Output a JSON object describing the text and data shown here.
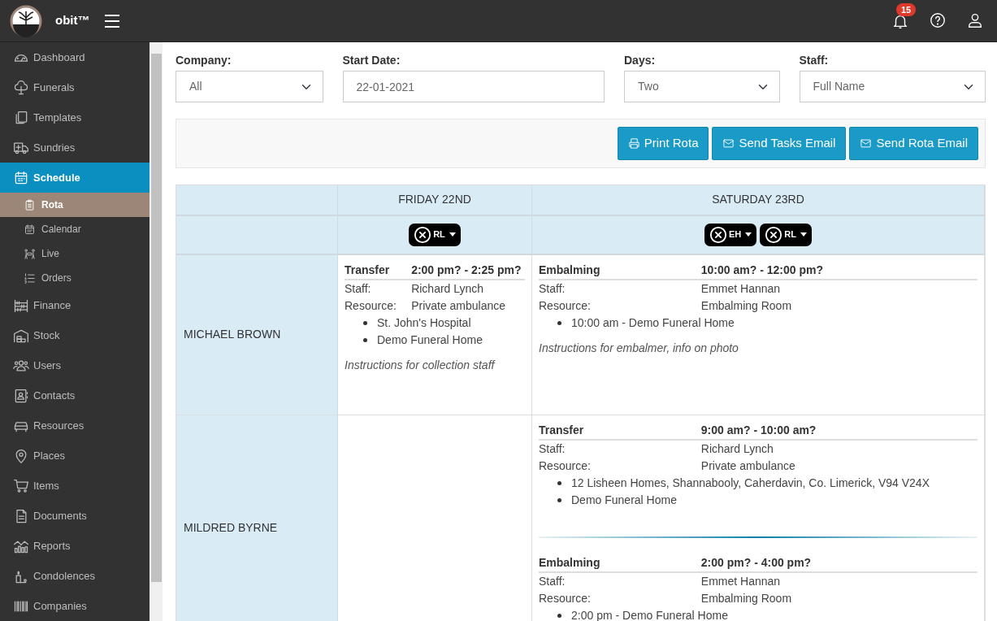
{
  "app": {
    "name": "obit™"
  },
  "header": {
    "notifications": "15"
  },
  "sidebar": {
    "items": [
      {
        "label": "Dashboard",
        "selected": false
      },
      {
        "label": "Funerals",
        "selected": false
      },
      {
        "label": "Templates",
        "selected": false
      },
      {
        "label": "Sundries",
        "selected": false
      },
      {
        "label": "Schedule",
        "selected": true,
        "children": [
          {
            "label": "Rota",
            "selected": true
          },
          {
            "label": "Calendar",
            "selected": false
          },
          {
            "label": "Live",
            "selected": false
          },
          {
            "label": "Orders",
            "selected": false
          }
        ]
      },
      {
        "label": "Finance",
        "selected": false
      },
      {
        "label": "Stock",
        "selected": false
      },
      {
        "label": "Users",
        "selected": false
      },
      {
        "label": "Contacts",
        "selected": false
      },
      {
        "label": "Resources",
        "selected": false
      },
      {
        "label": "Places",
        "selected": false
      },
      {
        "label": "Items",
        "selected": false
      },
      {
        "label": "Documents",
        "selected": false
      },
      {
        "label": "Reports",
        "selected": false
      },
      {
        "label": "Condolences",
        "selected": false
      },
      {
        "label": "Companies",
        "selected": false
      }
    ]
  },
  "filters": [
    {
      "label": "Company:",
      "kind": "select",
      "value": "All"
    },
    {
      "label": "Start Date:",
      "kind": "input",
      "value": "22-01-2021"
    },
    {
      "label": "Days:",
      "kind": "select",
      "value": "Two"
    },
    {
      "label": "Staff:",
      "kind": "select",
      "value": "Full Name"
    }
  ],
  "actions": [
    {
      "label": "Print Rota",
      "kind": "print"
    },
    {
      "label": "Send Tasks Email",
      "kind": "email"
    },
    {
      "label": "Send Rota Email",
      "kind": "email"
    }
  ],
  "rota": {
    "days": [
      {
        "title": "FRIDAY 22ND",
        "staff": [
          "RL"
        ]
      },
      {
        "title": "SATURDAY 23RD",
        "staff": [
          "EH",
          "RL"
        ]
      }
    ],
    "rows": [
      {
        "name": "MICHAEL BROWN",
        "cells": [
          [
            {
              "type": "Transfer",
              "time": "2:00 pm? - 2:25 pm?",
              "staff_label": "Staff:",
              "staff": "Richard Lynch",
              "resource_label": "Resource:",
              "resource": "Private ambulance",
              "stops": [
                "St. John's Hospital",
                "Demo Funeral Home"
              ],
              "instructions": "Instructions for collection staff"
            }
          ],
          [
            {
              "type": "Embalming",
              "time": "10:00 am? - 12:00 pm?",
              "staff_label": "Staff:",
              "staff": "Emmet Hannan",
              "resource_label": "Resource:",
              "resource": "Embalming Room",
              "stops": [
                "10:00 am - Demo Funeral Home"
              ],
              "instructions": "Instructions for embalmer, info on photo"
            }
          ]
        ]
      },
      {
        "name": "MILDRED BYRNE",
        "cells": [
          [],
          [
            {
              "type": "Transfer",
              "time": "9:00 am? - 10:00 am?",
              "staff_label": "Staff:",
              "staff": "Richard Lynch",
              "resource_label": "Resource:",
              "resource": "Private ambulance",
              "stops": [
                "12 Lisheen Homes, Shannabooly, Caherdavin, Co. Limerick, V94 V24X",
                "Demo Funeral Home"
              ]
            },
            {
              "type": "Embalming",
              "time": "2:00 pm? - 4:00 pm?",
              "staff_label": "Staff:",
              "staff": "Emmet Hannan",
              "resource_label": "Resource:",
              "resource": "Embalming Room",
              "stops": [
                "2:00 pm - Demo Funeral Home"
              ]
            }
          ]
        ]
      }
    ]
  }
}
